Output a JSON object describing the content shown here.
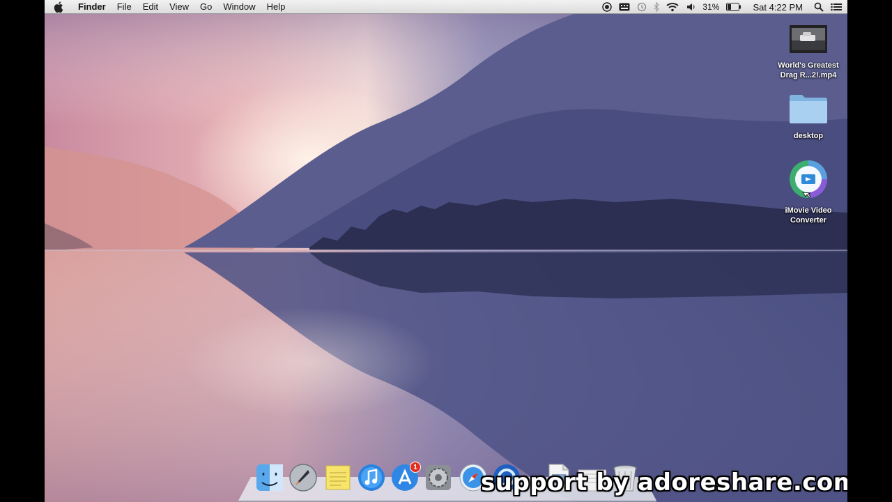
{
  "menubar": {
    "app_name": "Finder",
    "menus": [
      "File",
      "Edit",
      "View",
      "Go",
      "Window",
      "Help"
    ],
    "status": {
      "battery_percent": "31%",
      "clock": "Sat 4:22 PM",
      "icons": [
        "screen-record-icon",
        "keyboard-icon",
        "time-machine-icon",
        "bluetooth-icon",
        "wifi-icon",
        "volume-icon",
        "battery-icon",
        "spotlight-icon",
        "notification-center-icon"
      ]
    }
  },
  "desktop_icons": [
    {
      "name": "video-file",
      "label_line1": "World's Greatest",
      "label_line2": "Drag R...2!.mp4"
    },
    {
      "name": "folder",
      "label_line1": "desktop",
      "label_line2": ""
    },
    {
      "name": "app",
      "label_line1": "iMovie Video",
      "label_line2": "Converter"
    }
  ],
  "dock": {
    "items": [
      "finder-icon",
      "launchpad-icon",
      "stickies-icon",
      "itunes-icon",
      "app-store-icon",
      "system-preferences-icon",
      "safari-icon",
      "quicktime-icon",
      "document-icon",
      "document-icon",
      "trash-icon"
    ],
    "app_store_badge": "1"
  },
  "watermark": "support by adoreshare.com",
  "colors": {
    "menubar": "#e8e8e8",
    "sky_pink": "#e8b0b4",
    "mountain_blue": "#5c5f90",
    "badge_red": "#e0301e"
  }
}
